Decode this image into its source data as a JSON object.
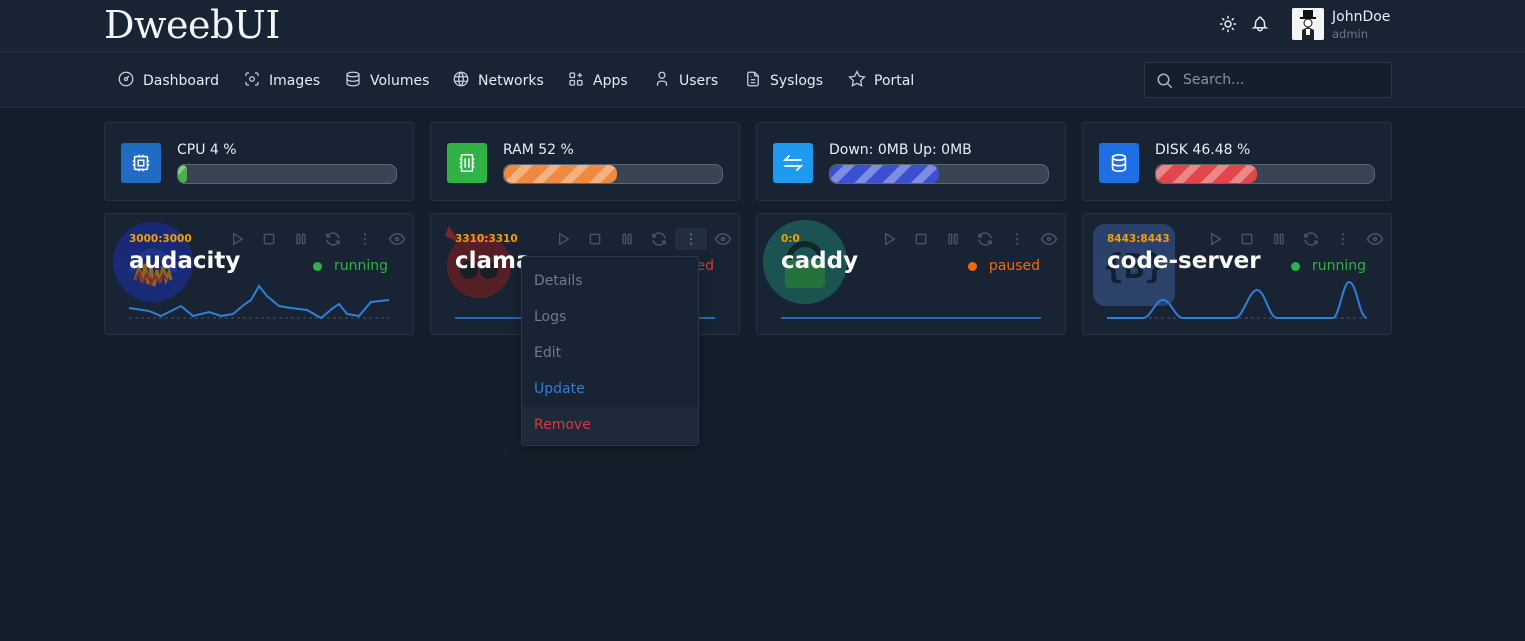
{
  "header": {
    "logo": "DweebUI",
    "user": {
      "name": "JohnDoe",
      "role": "admin"
    },
    "icons": [
      "sun-icon",
      "bell-icon"
    ]
  },
  "nav": {
    "items": [
      {
        "label": "Dashboard",
        "icon": "dashboard-icon"
      },
      {
        "label": "Images",
        "icon": "images-icon"
      },
      {
        "label": "Volumes",
        "icon": "volumes-icon"
      },
      {
        "label": "Networks",
        "icon": "globe-icon"
      },
      {
        "label": "Apps",
        "icon": "apps-icon"
      },
      {
        "label": "Users",
        "icon": "user-icon"
      },
      {
        "label": "Syslogs",
        "icon": "file-icon"
      },
      {
        "label": "Portal",
        "icon": "star-icon"
      }
    ],
    "search_placeholder": "Search..."
  },
  "stats": [
    {
      "label": "CPU 4 %",
      "percent": 4,
      "color": "#4cae4c",
      "icon": "cpu-icon",
      "icon_bg": "#206bc4"
    },
    {
      "label": "RAM 52 %",
      "percent": 52,
      "color": "#f0883e",
      "icon": "memory-icon",
      "icon_bg": "#2fb344"
    },
    {
      "label": "Down: 0MB Up: 0MB",
      "percent": 50,
      "color": "#3a4fd1",
      "icon": "transfer-icon",
      "icon_bg": "#1d9bf0"
    },
    {
      "label": "DISK 46.48 %",
      "percent": 46.48,
      "color": "#e0464a",
      "icon": "database-icon",
      "icon_bg": "#1e6fe6"
    }
  ],
  "containers": [
    {
      "name": "audacity",
      "port": "3000:3000",
      "status": "running",
      "status_color": "#2fb344",
      "logo": "audacity-logo-icon"
    },
    {
      "name": "clama",
      "port": "3310:3310",
      "status": "ed",
      "status_color": "#d63939",
      "logo": "clamav-logo-icon"
    },
    {
      "name": "caddy",
      "port": "0:0",
      "status": "paused",
      "status_color": "#f76707",
      "logo": "caddy-logo-icon"
    },
    {
      "name": "code-server",
      "port": "8443:8443",
      "status": "running",
      "status_color": "#2fb344",
      "logo": "code-server-logo-icon"
    }
  ],
  "card_actions": [
    "play-icon",
    "stop-icon",
    "pause-icon",
    "restart-icon",
    "more-vertical-icon",
    "eye-icon"
  ],
  "dropdown": {
    "items": [
      {
        "label": "Details",
        "color": "#6f7b8b"
      },
      {
        "label": "Logs",
        "color": "#6f7b8b"
      },
      {
        "label": "Edit",
        "color": "#6f7b8b"
      },
      {
        "label": "Update",
        "color": "#2f7fd8"
      },
      {
        "label": "Remove",
        "color": "#d63939"
      }
    ]
  },
  "colors": {
    "accent": "#206bc4",
    "background": "#151f2c",
    "card": "#182433",
    "sparkline": "#2f7fd8"
  }
}
